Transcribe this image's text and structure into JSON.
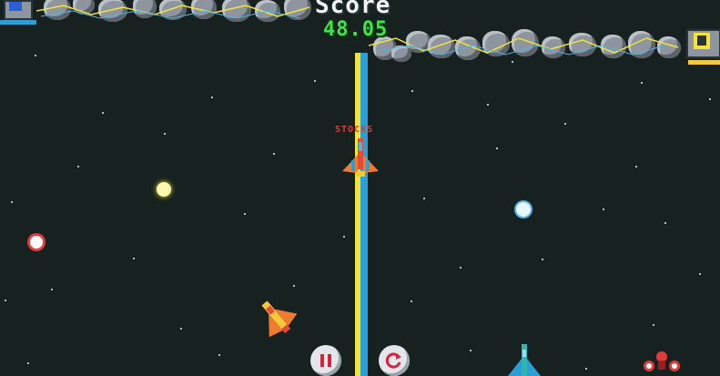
{
  "hud": {
    "score_title": "Score",
    "score_value": "48.05",
    "status_label": "STOCKS"
  },
  "controls": {
    "pause_icon": "pause-icon",
    "restart_icon": "restart-icon"
  },
  "colors": {
    "score_value": "#3fe24a",
    "status_label": "#e23b3b",
    "divider_yellow": "#f3e33b",
    "divider_blue": "#2a9fd6",
    "background": "#17211f"
  }
}
